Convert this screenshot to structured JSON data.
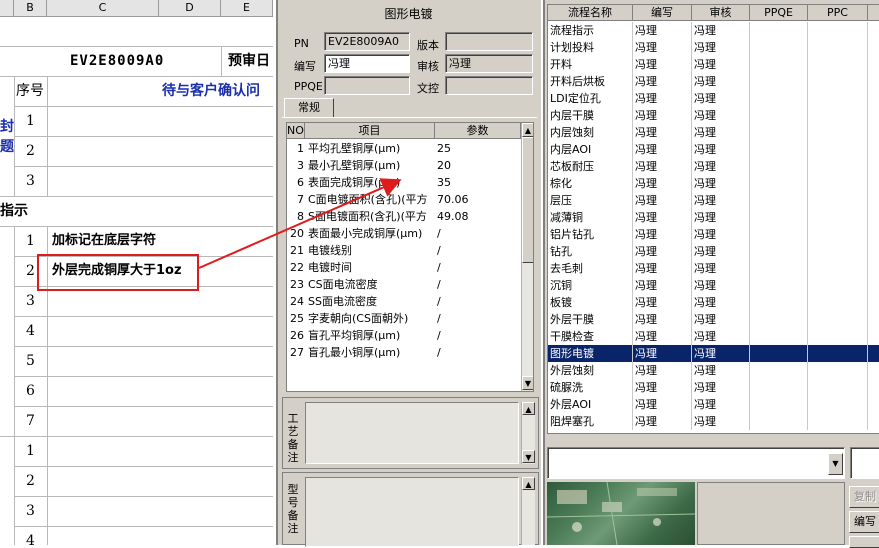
{
  "sheet": {
    "columns": [
      "B",
      "C",
      "D",
      "E"
    ],
    "doc_code": "EV2E8009A0",
    "approval_partial": "预审日",
    "seq_header": "序号",
    "pending_partial": "待与客户确认问",
    "left_clip_1": "封",
    "left_clip_2": "题",
    "section_partial": "指示",
    "rows_top": [
      "1",
      "2",
      "3"
    ],
    "rows_bottom": [
      "1",
      "2",
      "3",
      "4",
      "5",
      "6",
      "7",
      "1",
      "2",
      "3",
      "4"
    ],
    "instr_1": "加标记在底层字符",
    "instr_2": "外层完成铜厚大于1oz",
    "highlight_color": "#e01b1b"
  },
  "mid": {
    "title": "图形电镀",
    "pn_label": "PN",
    "pn_value": "EV2E8009A0",
    "version_label": "版本",
    "version_value": "",
    "edit_label": "编写",
    "edit_value": "冯理",
    "review_label": "审核",
    "review_value": "冯理",
    "ppqe_label": "PPQE",
    "ppqe_value": "",
    "doc_label": "文控",
    "doc_value": "",
    "tab_label": "常规",
    "grid_headers": [
      "NO",
      "项目",
      "参数"
    ],
    "grid_rows": [
      {
        "no": "1",
        "item": "平均孔壁铜厚(μm)",
        "param": "25"
      },
      {
        "no": "3",
        "item": "最小孔壁铜厚(μm)",
        "param": "20"
      },
      {
        "no": "6",
        "item": "表面完成铜厚(μm)",
        "param": "35"
      },
      {
        "no": "7",
        "item": "C面电镀面积(含孔)(平方",
        "param": "70.06"
      },
      {
        "no": "8",
        "item": "S面电镀面积(含孔)(平方",
        "param": "49.08"
      },
      {
        "no": "20",
        "item": "表面最小完成铜厚(μm)",
        "param": "/"
      },
      {
        "no": "21",
        "item": "电镀线别",
        "param": "/"
      },
      {
        "no": "22",
        "item": "电镀时间",
        "param": "/"
      },
      {
        "no": "23",
        "item": "CS面电流密度",
        "param": "/"
      },
      {
        "no": "24",
        "item": "SS面电流密度",
        "param": "/"
      },
      {
        "no": "25",
        "item": "字麦朝向(CS面朝外)",
        "param": "/"
      },
      {
        "no": "26",
        "item": "盲孔平均铜厚(μm)",
        "param": "/"
      },
      {
        "no": "27",
        "item": "盲孔最小铜厚(μm)",
        "param": "/"
      }
    ],
    "memo1_label": "工艺备注",
    "memo2_label": "型号备注"
  },
  "right": {
    "headers": [
      "流程名称",
      "编写",
      "审核",
      "PPQE",
      "PPC"
    ],
    "rows": [
      {
        "name": "流程指示",
        "edit": "冯理",
        "review": "冯理"
      },
      {
        "name": "计划投料",
        "edit": "冯理",
        "review": "冯理"
      },
      {
        "name": "开料",
        "edit": "冯理",
        "review": "冯理"
      },
      {
        "name": "开料后烘板",
        "edit": "冯理",
        "review": "冯理"
      },
      {
        "name": "LDI定位孔",
        "edit": "冯理",
        "review": "冯理"
      },
      {
        "name": "内层干膜",
        "edit": "冯理",
        "review": "冯理"
      },
      {
        "name": "内层蚀刻",
        "edit": "冯理",
        "review": "冯理"
      },
      {
        "name": "内层AOI",
        "edit": "冯理",
        "review": "冯理"
      },
      {
        "name": "芯板耐压",
        "edit": "冯理",
        "review": "冯理"
      },
      {
        "name": "棕化",
        "edit": "冯理",
        "review": "冯理"
      },
      {
        "name": "层压",
        "edit": "冯理",
        "review": "冯理"
      },
      {
        "name": "减薄铜",
        "edit": "冯理",
        "review": "冯理"
      },
      {
        "name": "铝片钻孔",
        "edit": "冯理",
        "review": "冯理"
      },
      {
        "name": "钻孔",
        "edit": "冯理",
        "review": "冯理"
      },
      {
        "name": "去毛刺",
        "edit": "冯理",
        "review": "冯理"
      },
      {
        "name": "沉铜",
        "edit": "冯理",
        "review": "冯理"
      },
      {
        "name": "板镀",
        "edit": "冯理",
        "review": "冯理"
      },
      {
        "name": "外层干膜",
        "edit": "冯理",
        "review": "冯理"
      },
      {
        "name": "干膜检查",
        "edit": "冯理",
        "review": "冯理"
      },
      {
        "name": "图形电镀",
        "edit": "冯理",
        "review": "冯理"
      },
      {
        "name": "外层蚀刻",
        "edit": "冯理",
        "review": "冯理"
      },
      {
        "name": "硫脲洗",
        "edit": "冯理",
        "review": "冯理"
      },
      {
        "name": "外层AOI",
        "edit": "冯理",
        "review": "冯理"
      },
      {
        "name": "阻焊塞孔",
        "edit": "冯理",
        "review": "冯理"
      }
    ],
    "selected_index": 19,
    "selection_color": "#0a246a",
    "btn_copy": "复制",
    "btn_edit": "编写",
    "btn_third": ""
  },
  "arrow_color": "#e01b1b"
}
